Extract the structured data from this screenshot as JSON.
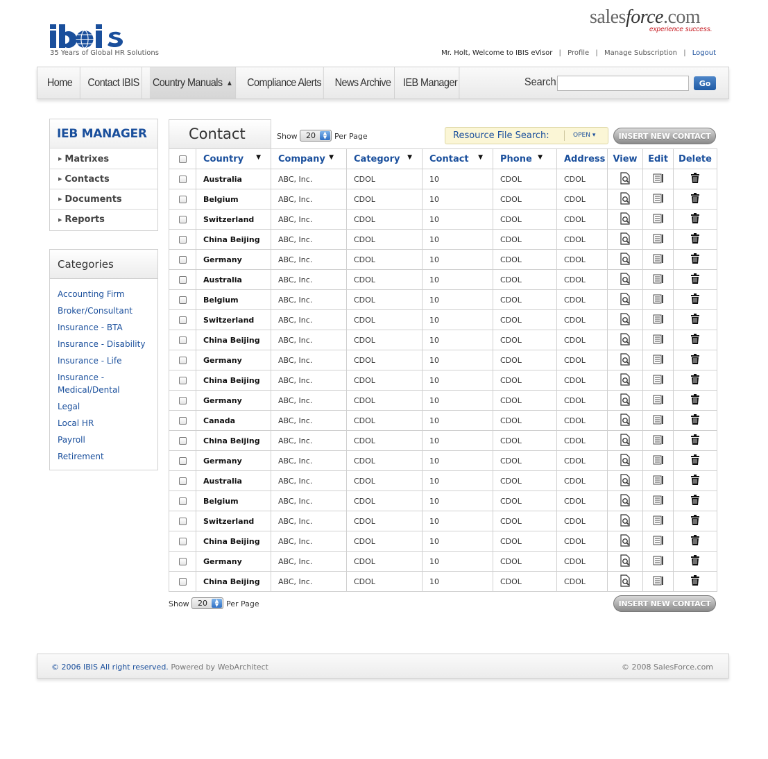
{
  "header": {
    "brand": "ibis",
    "tagline": "35 Years of Global HR Solutions",
    "partner_name_part1": "sales",
    "partner_name_part2": "force",
    "partner_name_part3": ".com",
    "partner_tagline": "experience success.",
    "welcome": "Mr. Holt, Welcome to IBIS eVisor",
    "links": {
      "profile": "Profile",
      "manage": "Manage Subscription",
      "logout": "Logout"
    },
    "sep": "|"
  },
  "nav": {
    "items": [
      "Home",
      "Contact IBIS",
      "Country Manuals",
      "Compliance Alerts",
      "News Archive",
      "IEB Manager"
    ],
    "search_label": "Search:",
    "search_value": "",
    "go_label": "Go"
  },
  "sidebar": {
    "title": "IEB MANAGER",
    "items": [
      "Matrixes",
      "Contacts",
      "Documents",
      "Reports"
    ],
    "categories_title": "Categories",
    "categories": [
      "Accounting Firm",
      "Broker/Consultant",
      "Insurance - BTA",
      "Insurance - Disability",
      "Insurance - Life",
      "Insurance - Medical/Dental",
      "Legal",
      "Local HR",
      "Payroll",
      "Retirement"
    ]
  },
  "content": {
    "title": "Contact",
    "show_label": "Show",
    "per_page_label": "Per Page",
    "per_page_value": "20",
    "resource_label": "Resource File Search:",
    "resource_open": "OPEN",
    "insert_label": "INSERT NEW CONTACT",
    "columns": [
      "Country",
      "Company",
      "Category",
      "Contact",
      "Phone",
      "Address",
      "View",
      "Edit",
      "Delete"
    ],
    "rows": [
      [
        "Australia",
        "ABC, Inc.",
        "CDOL",
        "10",
        "CDOL",
        "CDOL"
      ],
      [
        "Belgium",
        "ABC, Inc.",
        "CDOL",
        "10",
        "CDOL",
        "CDOL"
      ],
      [
        "Switzerland",
        "ABC, Inc.",
        "CDOL",
        "10",
        "CDOL",
        "CDOL"
      ],
      [
        "China Beijing",
        "ABC, Inc.",
        "CDOL",
        "10",
        "CDOL",
        "CDOL"
      ],
      [
        "Germany",
        "ABC, Inc.",
        "CDOL",
        "10",
        "CDOL",
        "CDOL"
      ],
      [
        "Australia",
        "ABC, Inc.",
        "CDOL",
        "10",
        "CDOL",
        "CDOL"
      ],
      [
        "Belgium",
        "ABC, Inc.",
        "CDOL",
        "10",
        "CDOL",
        "CDOL"
      ],
      [
        "Switzerland",
        "ABC, Inc.",
        "CDOL",
        "10",
        "CDOL",
        "CDOL"
      ],
      [
        "China Beijing",
        "ABC, Inc.",
        "CDOL",
        "10",
        "CDOL",
        "CDOL"
      ],
      [
        "Germany",
        "ABC, Inc.",
        "CDOL",
        "10",
        "CDOL",
        "CDOL"
      ],
      [
        "China Beijing",
        "ABC, Inc.",
        "CDOL",
        "10",
        "CDOL",
        "CDOL"
      ],
      [
        "Germany",
        "ABC, Inc.",
        "CDOL",
        "10",
        "CDOL",
        "CDOL"
      ],
      [
        "Canada",
        "ABC, Inc.",
        "CDOL",
        "10",
        "CDOL",
        "CDOL"
      ],
      [
        "China Beijing",
        "ABC, Inc.",
        "CDOL",
        "10",
        "CDOL",
        "CDOL"
      ],
      [
        "Germany",
        "ABC, Inc.",
        "CDOL",
        "10",
        "CDOL",
        "CDOL"
      ],
      [
        "Australia",
        "ABC, Inc.",
        "CDOL",
        "10",
        "CDOL",
        "CDOL"
      ],
      [
        "Belgium",
        "ABC, Inc.",
        "CDOL",
        "10",
        "CDOL",
        "CDOL"
      ],
      [
        "Switzerland",
        "ABC, Inc.",
        "CDOL",
        "10",
        "CDOL",
        "CDOL"
      ],
      [
        "China Beijing",
        "ABC, Inc.",
        "CDOL",
        "10",
        "CDOL",
        "CDOL"
      ],
      [
        "Germany",
        "ABC, Inc.",
        "CDOL",
        "10",
        "CDOL",
        "CDOL"
      ],
      [
        "China Beijing",
        "ABC, Inc.",
        "CDOL",
        "10",
        "CDOL",
        "CDOL"
      ]
    ]
  },
  "footer": {
    "copyright": "© 2006 IBIS All right reserved.",
    "powered": "Powered by WebArchitect",
    "right": "© 2008 SalesForce.com"
  },
  "colors": {
    "brand_blue": "#1a4f9c",
    "salesforce_red": "#c5161d"
  },
  "icons": {
    "view": "view-doc-icon",
    "edit": "edit-list-icon",
    "delete": "trash-icon"
  }
}
